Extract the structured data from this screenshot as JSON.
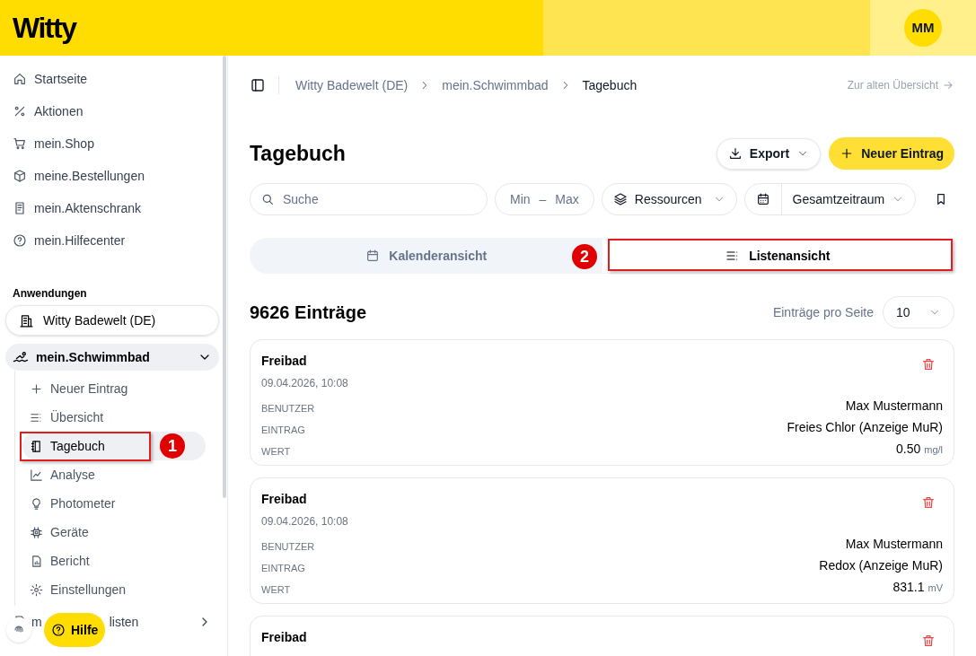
{
  "header": {
    "logo": "Witty",
    "avatar": "MM"
  },
  "sidebar": {
    "nav_items": [
      {
        "label": "Startseite"
      },
      {
        "label": "Aktionen"
      },
      {
        "label": "mein.Shop"
      },
      {
        "label": "meine.Bestellungen"
      },
      {
        "label": "mein.Aktenschrank"
      },
      {
        "label": "mein.Hilfecenter"
      }
    ],
    "section_title": "Anwendungen",
    "app": {
      "label": "Witty Badewelt (DE)"
    },
    "group": {
      "label": "mein.Schwimmbad",
      "expanded": true,
      "items": [
        {
          "label": "Neuer Eintrag",
          "selected": false
        },
        {
          "label": "Übersicht",
          "selected": false
        },
        {
          "label": "Tagebuch",
          "selected": true
        },
        {
          "label": "Analyse",
          "selected": false
        },
        {
          "label": "Photometer",
          "selected": false
        },
        {
          "label": "Geräte",
          "selected": false
        },
        {
          "label": "Bericht",
          "selected": false
        },
        {
          "label": "Einstellungen",
          "selected": false
        }
      ]
    },
    "partial_item": {
      "label_start": "m",
      "label_end": "listen"
    },
    "help_button": "Hilfe"
  },
  "breadcrumb": [
    "Witty Badewelt (DE)",
    "mein.Schwimmbad",
    "Tagebuch"
  ],
  "old_overview_link": "Zur alten Übersicht",
  "page_title": "Tagebuch",
  "actions": {
    "export": "Export",
    "new_entry": "Neuer Eintrag"
  },
  "filters": {
    "search": {
      "placeholder": "Suche"
    },
    "min": "Min",
    "dash": "–",
    "max": "Max",
    "resources": "Ressourcen",
    "period": "Gesamtzeitraum"
  },
  "tabs": [
    {
      "label": "Kalenderansicht",
      "selected": false
    },
    {
      "label": "Listenansicht",
      "selected": true
    }
  ],
  "count": "9626 Einträge",
  "page_size": {
    "label": "Einträge pro Seite",
    "value": "10"
  },
  "entries": [
    {
      "title": "Freibad",
      "date": "09.04.2026, 10:08",
      "fields": [
        {
          "label": "BENUTZER",
          "value": "Max Mustermann"
        },
        {
          "label": "EINTRAG",
          "value": "Freies Chlor (Anzeige MuR)"
        },
        {
          "label": "WERT",
          "value": "0.50",
          "unit": "mg/l"
        }
      ]
    },
    {
      "title": "Freibad",
      "date": "09.04.2026, 10:08",
      "fields": [
        {
          "label": "BENUTZER",
          "value": "Max Mustermann"
        },
        {
          "label": "EINTRAG",
          "value": "Redox (Anzeige MuR)"
        },
        {
          "label": "WERT",
          "value": "831.1",
          "unit": "mV"
        }
      ]
    },
    {
      "title": "Freibad"
    }
  ],
  "annotations": [
    {
      "label": "1"
    },
    {
      "label": "2"
    }
  ]
}
